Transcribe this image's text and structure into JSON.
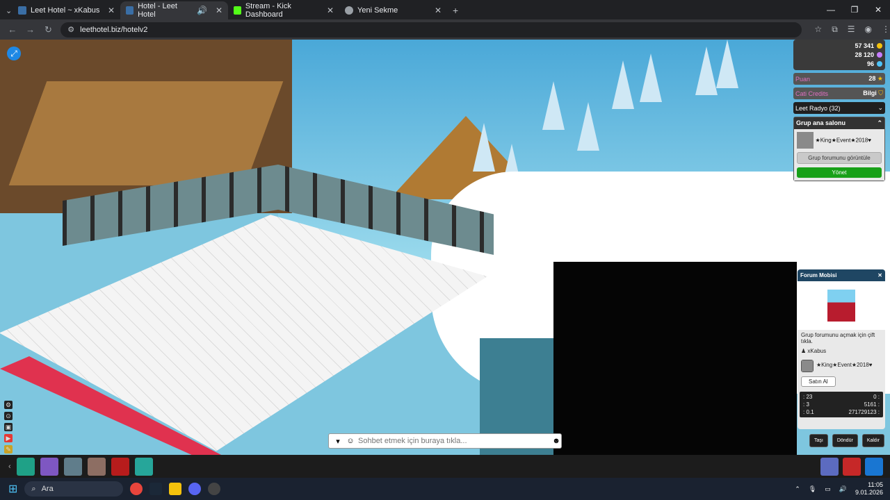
{
  "browser": {
    "tabs": [
      {
        "label": "Leet Hotel ~ xKabus",
        "active": false
      },
      {
        "label": "Hotel - Leet Hotel",
        "active": true
      },
      {
        "label": "Stream - Kick Dashboard",
        "active": false
      },
      {
        "label": "Yeni Sekme",
        "active": false
      }
    ],
    "url": "leethotel.biz/hotelv2"
  },
  "hud": {
    "currency": {
      "credits": "57 341",
      "duckets": "28 120",
      "diamonds": "96"
    },
    "bar1": {
      "label": "Puan",
      "value": "28"
    },
    "bar2": {
      "label": "Cati Credits",
      "value": "Bilgi"
    },
    "radio": "Leet Radyo (32)",
    "group": {
      "header": "Grup ana salonu",
      "name": "★King★Event★2018♥",
      "view_forum": "Grup forumunu görüntüle",
      "manage": "Yönet"
    }
  },
  "forum_panel": {
    "title": "Forum Mobisi",
    "desc": "Grup forumunu açmak için çift tıkla.",
    "owner": "xKabus",
    "group_name": "★King★Event★2018♥",
    "buy": "Satın Al",
    "stats": [
      {
        "left": ": 23",
        "right": "0 :"
      },
      {
        "left": ": 3",
        "right": "5161 :"
      },
      {
        "left": ": 0.1",
        "right": "271729123 :"
      }
    ]
  },
  "actions": {
    "move": "Taşı",
    "rotate": "Döndür",
    "pickup": "Kaldır"
  },
  "chat": {
    "placeholder": "Sohbet etmek için buraya tıkla..."
  },
  "taskbar": {
    "search": "Ara",
    "time": "11:05",
    "date": "9.01.2026"
  }
}
